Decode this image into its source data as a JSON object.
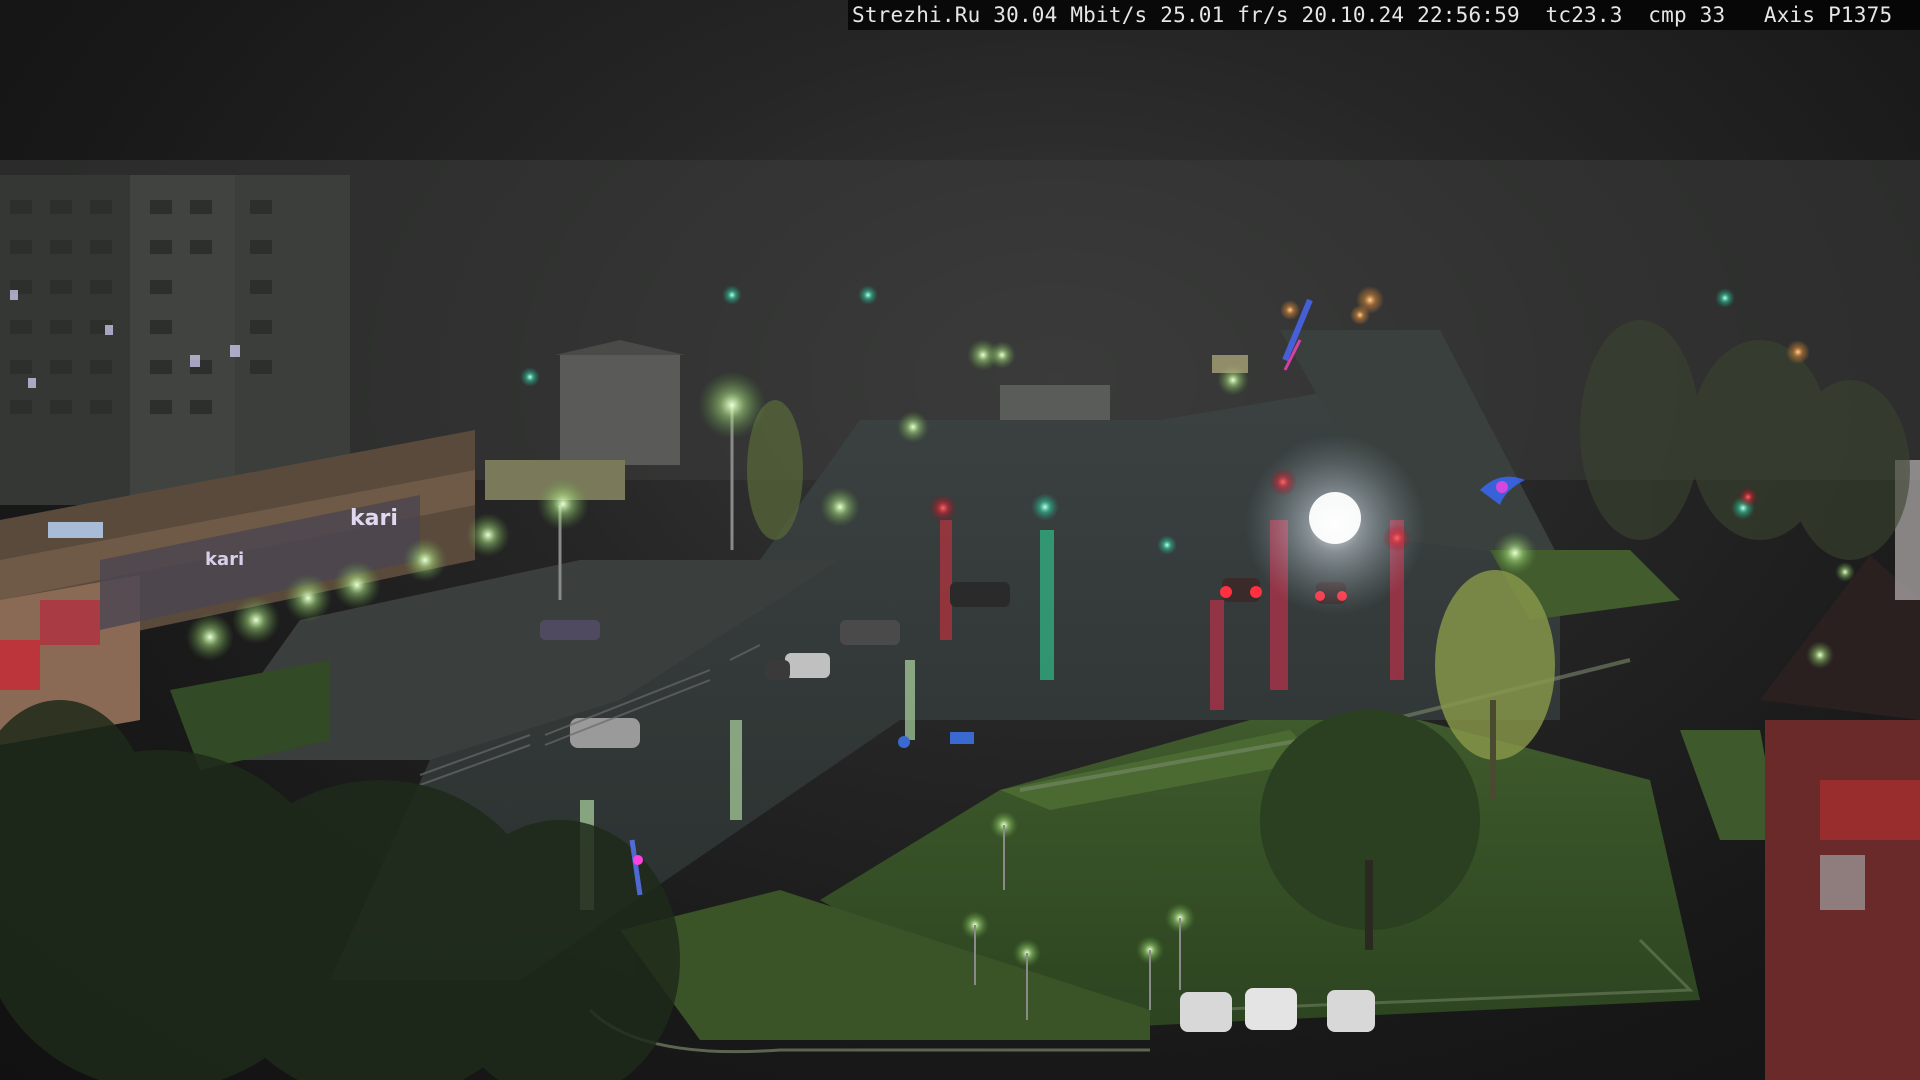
{
  "overlay": {
    "text": "Strezhi.Ru 30.04 Mbit/s 25.01 fr/s 20.10.24 22:56:59  tc23.3  cmp 33   Axis P1375"
  },
  "signs": {
    "store_left": "kari",
    "store_left2": "kari"
  }
}
